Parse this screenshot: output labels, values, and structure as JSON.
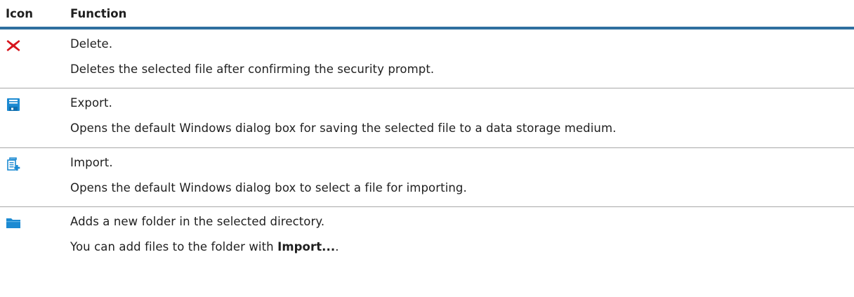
{
  "header": {
    "icon": "Icon",
    "function": "Function"
  },
  "rows": [
    {
      "icon": "delete-x-icon",
      "title": "Delete.",
      "description": "Deletes the selected file after confirming the security prompt."
    },
    {
      "icon": "save-disk-icon",
      "title": "Export.",
      "description": "Opens the default Windows dialog box for saving the selected file to a data storage medium."
    },
    {
      "icon": "import-document-icon",
      "title": "Import.",
      "description": "Opens the default Windows dialog box to select a file for importing."
    },
    {
      "icon": "folder-icon",
      "title": "Adds a new folder in the selected directory.",
      "description_prefix": "You can add files to the folder with ",
      "description_bold": "Import...",
      "description_suffix": "."
    }
  ],
  "colors": {
    "header_rule": "#2f6f9f",
    "row_rule": "#a8a8a8",
    "delete_red": "#d7141c",
    "icon_blue": "#1c8ad2"
  }
}
